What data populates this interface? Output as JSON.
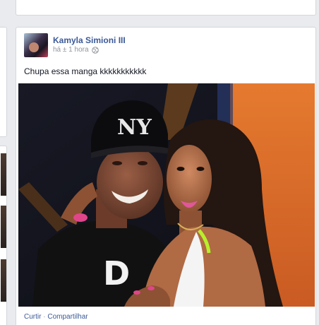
{
  "post": {
    "author": "Kamyla Simioni III",
    "timestamp": "há ± 1 hora",
    "privacy_icon": "globe-icon",
    "text": "Chupa essa manga kkkkkkkkkkk",
    "photo_cap_text": "NY",
    "shirt_text": "D",
    "actions": {
      "like": "Curtir",
      "separator": "·",
      "share": "Compartilhar"
    }
  },
  "colors": {
    "link": "#3b5998",
    "meta": "#90949c",
    "background": "#e9ebee",
    "photo_orange_wall": "#e0742e"
  }
}
